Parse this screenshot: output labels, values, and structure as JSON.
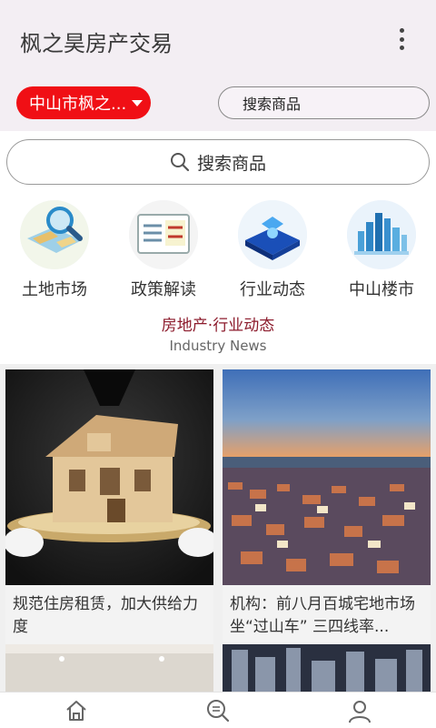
{
  "app": {
    "title": "枫之昊房产交易"
  },
  "toolbar": {
    "city_label": "中山市枫之...",
    "search_placeholder": "搜索商品"
  },
  "search": {
    "label": "搜索商品"
  },
  "categories": [
    {
      "label": "土地市场",
      "icon": "map-magnifier-icon"
    },
    {
      "label": "政策解读",
      "icon": "policy-board-icon"
    },
    {
      "label": "行业动态",
      "icon": "industry-cube-icon"
    },
    {
      "label": "中山楼市",
      "icon": "city-skyline-icon"
    }
  ],
  "section": {
    "title": "房地产·行业动态",
    "subtitle": "Industry News"
  },
  "articles": [
    {
      "caption": "规范住房租赁，加大供给力度"
    },
    {
      "caption": "机构：前八月百城宅地市场坐“过山车” 三四线率..."
    },
    {
      "caption": ""
    },
    {
      "caption": ""
    }
  ],
  "tabs": [
    {
      "icon": "home-icon"
    },
    {
      "icon": "news-search-icon"
    },
    {
      "icon": "user-icon"
    }
  ],
  "colors": {
    "accent": "#f00f15",
    "section_title": "#8c1b2c",
    "appbar_bg": "#f3eef3"
  }
}
